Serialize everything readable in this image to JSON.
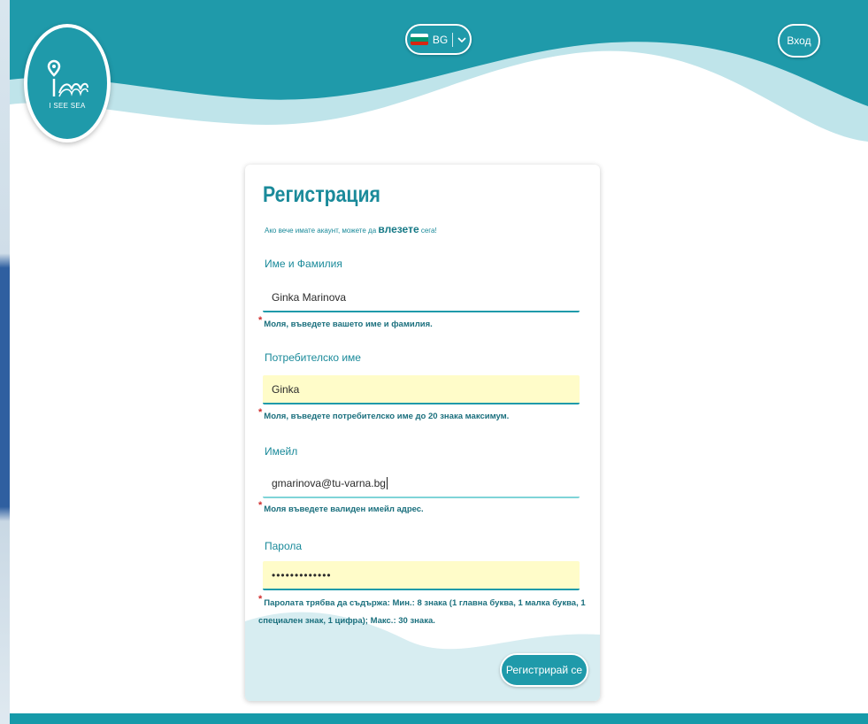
{
  "header": {
    "logo_text": "I SEE SEA",
    "language": "BG",
    "login_label": "Вход"
  },
  "form": {
    "title": "Регистрация",
    "subtitle_prefix": "Ако вече имате акаунт, можете да",
    "subtitle_link": "влезете",
    "subtitle_suffix": "сега!",
    "fields": [
      {
        "label": "Име и Фамилия",
        "value": "Ginka Marinova",
        "hint": "Моля, въведете вашето име и фамилия."
      },
      {
        "label": "Потребителско име",
        "value": "Ginka",
        "hint": "Моля, въведете потребителско име до 20 знака максимум."
      },
      {
        "label": "Имейл",
        "value": "gmarinova@tu-varna.bg",
        "hint": "Моля въведете валиден имейл адрес."
      },
      {
        "label": "Парола",
        "value": "•••••••••••••",
        "hint": "Паролата трябва да съдържа: Мин.: 8 знака (1 главна буква, 1 малка буква, 1 специален знак, 1 цифра); Макс.: 30 знака."
      }
    ],
    "required_mark": "*",
    "submit_label": "Регистрирай се"
  },
  "colors": {
    "primary": "#1f9aaa",
    "autofill": "#fffcc9",
    "required": "#d02d2d"
  }
}
